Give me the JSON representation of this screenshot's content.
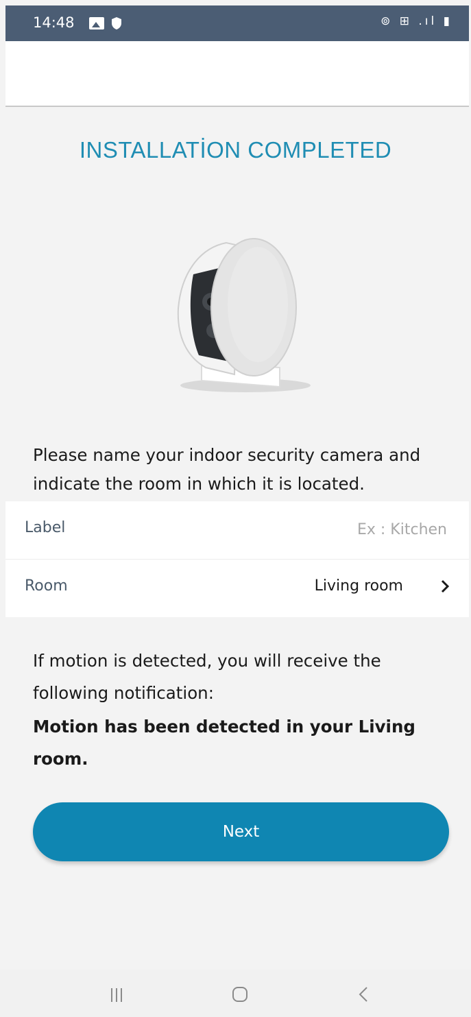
{
  "status_bar": {
    "time": "14:48",
    "system_icons": "⊚ ⊞ .ıl ▮",
    "background": "#4b5d74"
  },
  "title": "INSTALLATİON COMPLETED",
  "instructions": "Please name your indoor security camera and indicate the room in which it is located.",
  "form": {
    "label_field": {
      "label": "Label",
      "placeholder": "Ex : Kitchen",
      "value": ""
    },
    "room_field": {
      "label": "Room",
      "value": "Living room"
    }
  },
  "notice": {
    "text": "If motion is detected, you will receive the following notification:",
    "message": "Motion has been detected in your Living room."
  },
  "next_button": {
    "label": "Next",
    "color": "#0f86b2"
  },
  "colors": {
    "accent": "#1f8db3",
    "background": "#f3f3f3"
  },
  "icons": [
    "gallery-icon",
    "shield-icon",
    "camera-image",
    "chevron-right-icon",
    "recents-icon",
    "home-icon",
    "back-icon"
  ]
}
